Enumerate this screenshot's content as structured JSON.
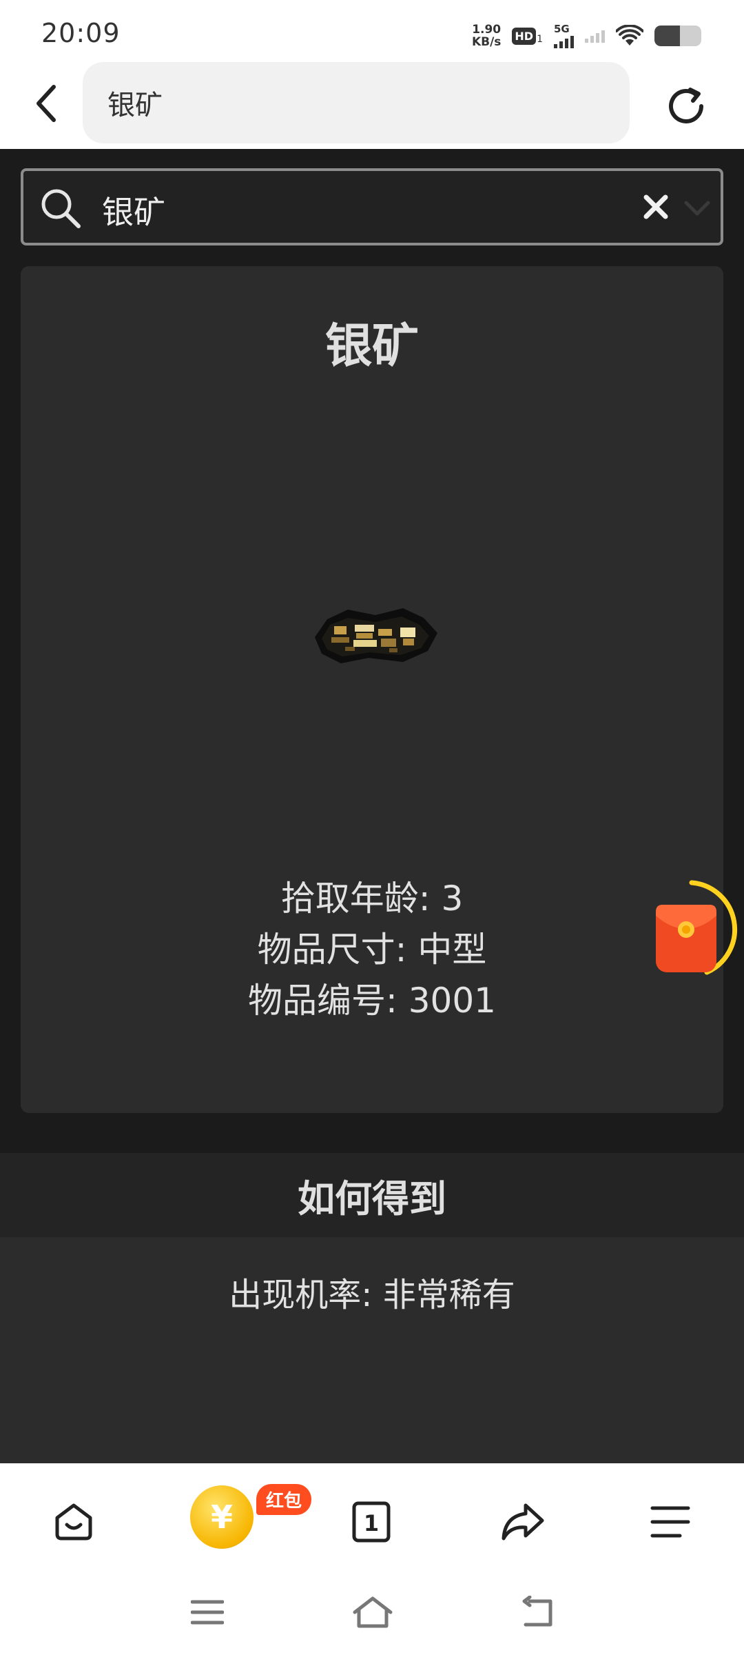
{
  "status_bar": {
    "time": "20:09",
    "net_speed_value": "1.90",
    "net_speed_unit": "KB/s",
    "hd_label": "HD",
    "hd_sub": "1",
    "network_type": "5G",
    "battery_level": 0.55
  },
  "address_bar": {
    "query": "银矿"
  },
  "search": {
    "value": "银矿"
  },
  "item": {
    "title": "银矿",
    "pickup_age": "拾取年龄: 3",
    "item_size": "物品尺寸: 中型",
    "item_id": "物品编号: 3001"
  },
  "how_to_get": {
    "heading": "如何得到",
    "appearance_rate": "出现机率: 非常稀有"
  },
  "toolbar": {
    "coin_symbol": "¥",
    "red_packet_badge": "红包",
    "tab_count": "1"
  },
  "colors": {
    "page_bg": "#1b1b1b",
    "card_bg": "#2c2c2c",
    "text": "#e2e2e2",
    "red_packet": "#ff4d1f",
    "coin": "#f7b500"
  }
}
